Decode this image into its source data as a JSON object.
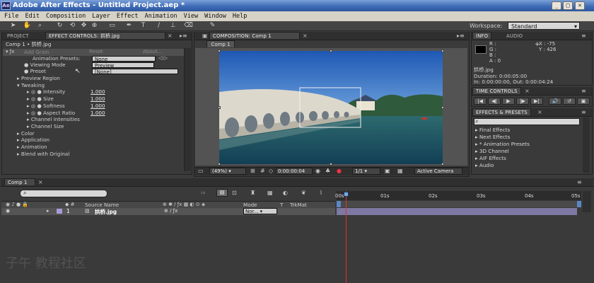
{
  "app": {
    "title": "Adobe After Effects - Untitled Project.aep *",
    "icon_text": "Ae",
    "window_buttons": [
      "_",
      "□",
      "×"
    ]
  },
  "menu": [
    "File",
    "Edit",
    "Composition",
    "Layer",
    "Effect",
    "Animation",
    "View",
    "Window",
    "Help"
  ],
  "toolbar": {
    "tools": [
      "selection-tool",
      "hand-tool",
      "zoom-tool",
      "rotation-tool",
      "orbit-camera-tool",
      "track-xy-tool",
      "track-z-tool",
      "pan-behind-tool",
      "rectangle-tool",
      "pen-tool",
      "type-tool",
      "brush-tool",
      "clone-stamp-tool",
      "eraser-tool",
      "puppet-pin-tool"
    ],
    "workspace_label": "Workspace:",
    "workspace_value": "Standard"
  },
  "left_panel": {
    "tabs": [
      "PROJECT",
      "EFFECT CONTROLS: 拱桥.jpg"
    ],
    "breadcrumb": "Comp 1 • 拱桥.jpg",
    "effect_name": "Add Grain",
    "reset_label": "Reset",
    "about_label": "About...",
    "rows": [
      {
        "label": "Animation Presets:",
        "value": "None"
      },
      {
        "label": "Viewing Mode",
        "value": "Preview"
      },
      {
        "label": "Preset",
        "value": "[None]"
      },
      {
        "label": "Preview Region",
        "value": ""
      },
      {
        "label": "Tweaking",
        "value": ""
      },
      {
        "label": "Intensity",
        "value": "1.000"
      },
      {
        "label": "Size",
        "value": "1.000"
      },
      {
        "label": "Softness",
        "value": "1.000"
      },
      {
        "label": "Aspect Ratio",
        "value": "1.000"
      },
      {
        "label": "Channel Intensities",
        "value": ""
      },
      {
        "label": "Channel Size",
        "value": ""
      },
      {
        "label": "Color",
        "value": ""
      },
      {
        "label": "Application",
        "value": ""
      },
      {
        "label": "Animation",
        "value": ""
      },
      {
        "label": "Blend with Original",
        "value": ""
      }
    ]
  },
  "composition": {
    "tab": "COMPOSITION: Comp 1",
    "inner_tab": "Comp 1",
    "zoom": "(49%)",
    "timecode": "0:00:00:04",
    "resolution": "1/1",
    "camera": "Active Camera"
  },
  "info": {
    "tabs": [
      "INFO",
      "AUDIO"
    ],
    "r": "R :",
    "g": "G :",
    "b": "B :",
    "a": "A : 0",
    "x": "X : -75",
    "y": "Y : 426",
    "filename": "拱桥.jpg",
    "duration": "Duration: 0:00:05:00",
    "inout": "In: 0:00:00:00, Out: 0:00:04:24"
  },
  "time_controls": {
    "tab": "TIME CONTROLS",
    "buttons": [
      "|◀",
      "◀|",
      "▶",
      "|▶",
      "▶|",
      "🔊",
      "↺",
      "▣"
    ]
  },
  "effects_presets": {
    "tab": "EFFECTS & PRESETS",
    "search_placeholder": "",
    "items": [
      "Final Effects",
      "Next Effects",
      "* Animation Presets",
      "3D Channel",
      "AIF Effects",
      "Audio"
    ]
  },
  "timeline": {
    "tab": "Comp 1",
    "columns": [
      "Source Name",
      "Mode",
      "T",
      "TrkMat"
    ],
    "ruler": [
      "00s",
      "01s",
      "02s",
      "03s",
      "04s",
      "05s"
    ],
    "layer": {
      "index": "1",
      "name": "拱桥.jpg",
      "mode": "Nor..."
    },
    "watermark": "子午 教程社区"
  },
  "colors": {
    "titlebar": "#3f6cb6",
    "playhead": "#d33",
    "layer_bar": "#7c79a2"
  }
}
